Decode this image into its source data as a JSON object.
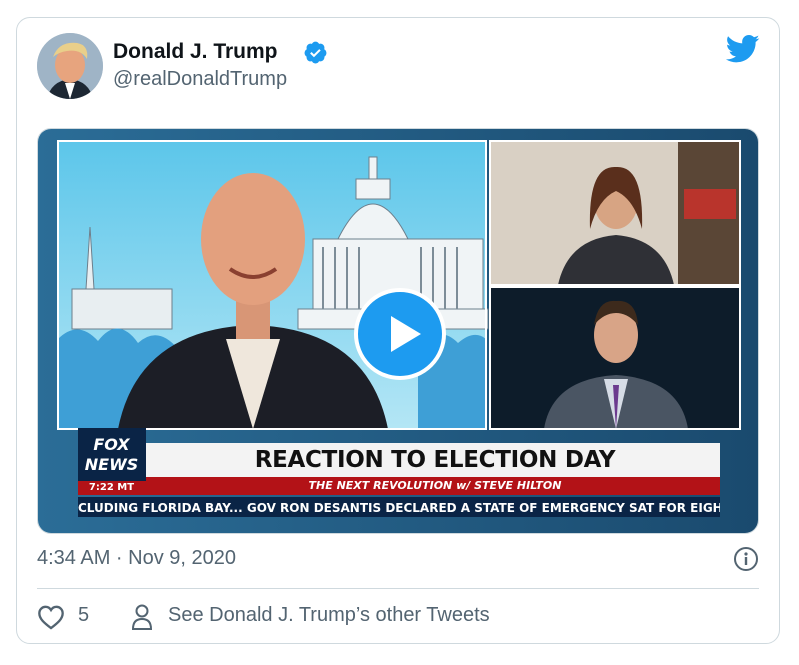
{
  "author": {
    "name": "Donald J. Trump",
    "handle": "@realDonaldTrump",
    "verified": true
  },
  "media": {
    "headline": "REACTION TO ELECTION DAY",
    "show": "THE NEXT REVOLUTION w/ STEVE HILTON",
    "crawl": "CLUDING FLORIDA BAY...   GOV RON DESANTIS DECLARED A STATE OF EMERGENCY SAT FOR EIGHT COUNT",
    "channel_logo_text": "FOX NEWS",
    "time": "7:22 MT"
  },
  "meta": {
    "timestamp": "4:34 AM · Nov 9, 2020"
  },
  "actions": {
    "likes": "5",
    "other_tweets": "See Donald J. Trump’s other Tweets"
  },
  "colors": {
    "twitter_blue": "#1d9bf0",
    "text_primary": "#0f1419",
    "text_secondary": "#536471",
    "border": "#cfd9de"
  },
  "icons": [
    "verified-badge-icon",
    "twitter-bird-icon",
    "play-icon",
    "info-icon",
    "heart-icon",
    "person-icon"
  ]
}
